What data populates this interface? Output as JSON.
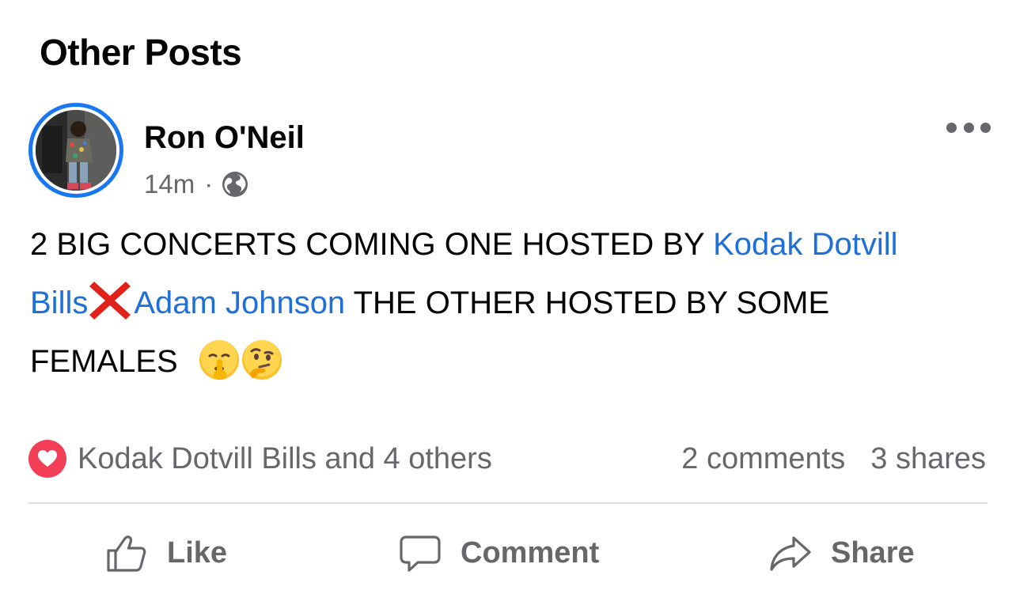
{
  "section": {
    "title": "Other Posts"
  },
  "post": {
    "author": "Ron O'Neil",
    "time": "14m",
    "separator": "·",
    "privacy_icon": "globe-icon",
    "more_icon": "more-options-icon",
    "text": {
      "part1": "2 BIG CONCERTS COMING ONE HOSTED BY ",
      "mention1": "Kodak Dotvill",
      "mention1_cont": "Bills",
      "cross_emoji": "❌",
      "mention2": "Adam Johnson",
      "part2": " THE OTHER HOSTED BY SOME",
      "part3": "FEMALES ",
      "emoji1": "🤫",
      "emoji2": "🤔"
    },
    "reactions": {
      "icon": "heart-reaction-icon",
      "summary": "Kodak Dotvill Bills and 4 others"
    },
    "comments": "2 comments",
    "shares": "3 shares"
  },
  "actions": {
    "like": "Like",
    "comment": "Comment",
    "share": "Share"
  },
  "colors": {
    "accent": "#1877f2",
    "mention": "#1f6fd8",
    "secondary_text": "#65676b",
    "heart": "#f33e58",
    "divider": "#dddfe2"
  }
}
